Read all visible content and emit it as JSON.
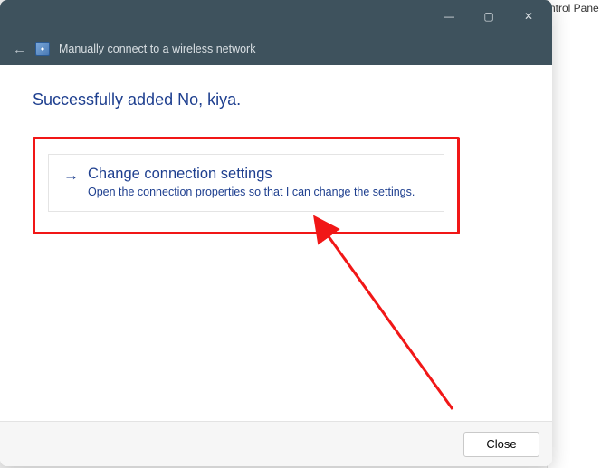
{
  "background": {
    "partial_text": "ntrol Pane"
  },
  "titlebar": {
    "minimize_glyph": "—",
    "maximize_glyph": "▢",
    "close_glyph": "✕"
  },
  "header": {
    "back_glyph": "←",
    "title": "Manually connect to a wireless network"
  },
  "content": {
    "heading": "Successfully added No, kiya.",
    "option": {
      "arrow_glyph": "→",
      "title": "Change connection settings",
      "description": "Open the connection properties so that I can change the settings."
    }
  },
  "footer": {
    "close_label": "Close"
  },
  "annotation": {
    "highlight_color": "#f11717"
  }
}
